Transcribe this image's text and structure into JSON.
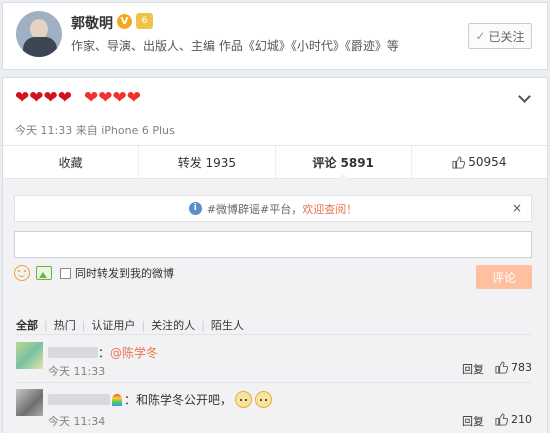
{
  "profile": {
    "name": "郭敬明",
    "desc": "作家、导演、出版人、主编 作品《幻城》《小时代》《爵迹》等",
    "follow_label": "已关注",
    "verified_icon": "verified-v-icon",
    "level_icon": "level-badge-icon"
  },
  "post": {
    "hearts_group1": 4,
    "hearts_group2": 4,
    "time": "今天 11:33",
    "source_prefix": "来自",
    "source": "iPhone 6 Plus"
  },
  "actions": {
    "favorite": "收藏",
    "repost": "转发 1935",
    "comment": "评论 5891",
    "like_count": "50954"
  },
  "notice": {
    "text": "#微博辟谣#平台，",
    "link": "欢迎查阅！",
    "close": "×"
  },
  "composer": {
    "placeholder": "",
    "repost_label": "同时转发到我的微博",
    "submit": "评论"
  },
  "filters": [
    "全部",
    "热门",
    "认证用户",
    "关注的人",
    "陌生人"
  ],
  "comments": [
    {
      "text": "：",
      "mention": "@陈学冬",
      "time": "今天 11:33",
      "reply": "回复",
      "likes": "783"
    },
    {
      "text": "：和陈学冬公开吧，",
      "time": "今天 11:34",
      "reply": "回复",
      "likes": "210"
    }
  ],
  "colors": {
    "accent": "#eb7350",
    "heart_dark": "#d0141b",
    "heart_bright": "#f0312c",
    "submit_disabled": "#ffc09f"
  }
}
